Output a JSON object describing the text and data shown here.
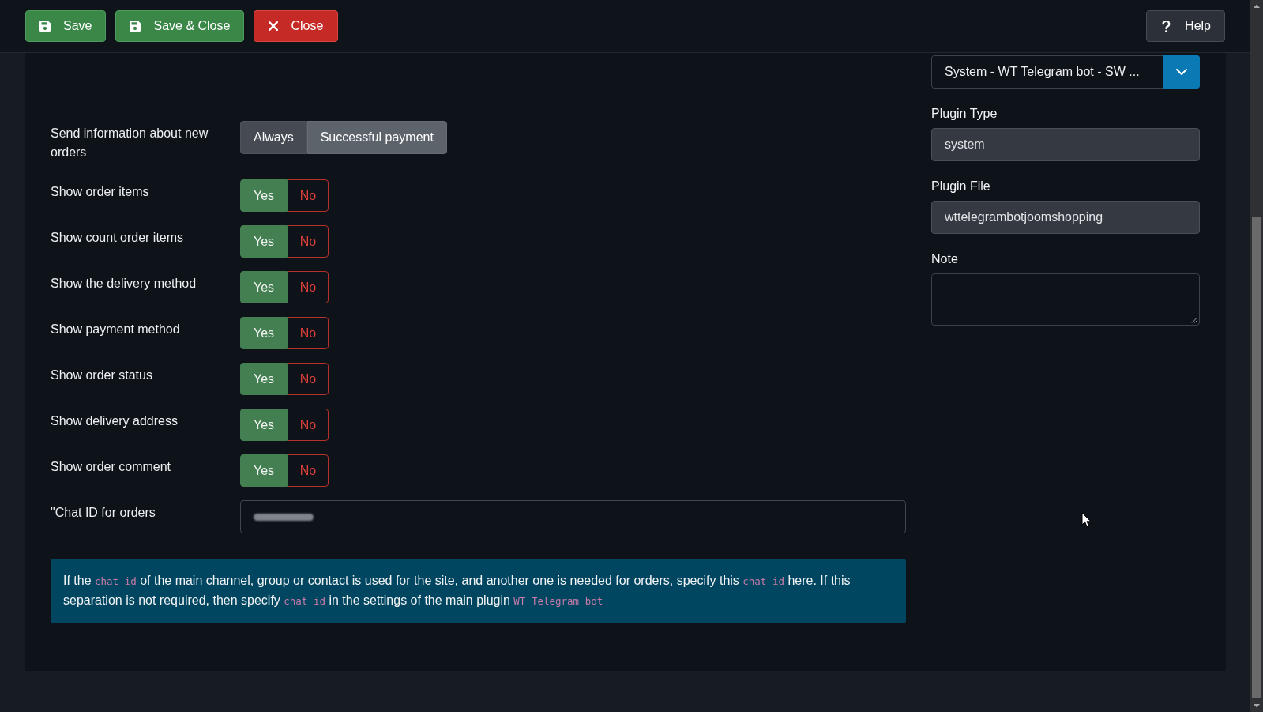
{
  "toolbar": {
    "buttons": [
      {
        "kind": "save",
        "label": "Save"
      },
      {
        "kind": "save_close",
        "label": "Save & Close"
      },
      {
        "kind": "close",
        "label": "Close"
      }
    ],
    "help_button": {
      "label": "Help"
    }
  },
  "settings": {
    "new_orders_notice": {
      "label": "Send information about new orders",
      "options": [
        {
          "label": "Always",
          "selected": false
        },
        {
          "label": "Successful payment",
          "selected": true
        }
      ]
    },
    "toggles": [
      {
        "label": "Show order items",
        "options": [
          {
            "kind": "yes",
            "label": "Yes",
            "selected": true
          },
          {
            "kind": "no",
            "label": "No",
            "selected": false
          }
        ]
      },
      {
        "label": "Show count order items",
        "options": [
          {
            "kind": "yes",
            "label": "Yes",
            "selected": true
          },
          {
            "kind": "no",
            "label": "No",
            "selected": false
          }
        ]
      },
      {
        "label": "Show the delivery method",
        "options": [
          {
            "kind": "yes",
            "label": "Yes",
            "selected": true
          },
          {
            "kind": "no",
            "label": "No",
            "selected": false
          }
        ]
      },
      {
        "label": "Show payment method",
        "options": [
          {
            "kind": "yes",
            "label": "Yes",
            "selected": true
          },
          {
            "kind": "no",
            "label": "No",
            "selected": false
          }
        ]
      },
      {
        "label": "Show order status",
        "options": [
          {
            "kind": "yes",
            "label": "Yes",
            "selected": true
          },
          {
            "kind": "no",
            "label": "No",
            "selected": false
          }
        ]
      },
      {
        "label": "Show delivery address",
        "options": [
          {
            "kind": "yes",
            "label": "Yes",
            "selected": true
          },
          {
            "kind": "no",
            "label": "No",
            "selected": false
          }
        ]
      },
      {
        "label": "Show order comment",
        "options": [
          {
            "kind": "yes",
            "label": "Yes",
            "selected": true
          },
          {
            "kind": "no",
            "label": "No",
            "selected": false
          }
        ]
      }
    ],
    "chat_id": {
      "label": "\"Chat ID for orders",
      "redacted": true
    },
    "info_message": [
      {
        "kind": "text",
        "text": "If the "
      },
      {
        "kind": "code",
        "text": "chat id"
      },
      {
        "kind": "text",
        "text": " of the main channel, group or contact is used for the site, and another one is needed for orders, specify this "
      },
      {
        "kind": "code",
        "text": "chat id"
      },
      {
        "kind": "text",
        "text": " here. If this separation is not required, then specify "
      },
      {
        "kind": "code",
        "text": "chat id"
      },
      {
        "kind": "text",
        "text": " in the settings of the main plugin "
      },
      {
        "kind": "code",
        "text": "WT Telegram bot"
      }
    ]
  },
  "plugin": {
    "select": {
      "value": "System - WT Telegram bot - SW ..."
    },
    "type": {
      "label": "Plugin Type",
      "value": "system"
    },
    "file": {
      "label": "Plugin File",
      "value": "wttelegrambotjoomshopping"
    },
    "note": {
      "label": "Note"
    }
  }
}
